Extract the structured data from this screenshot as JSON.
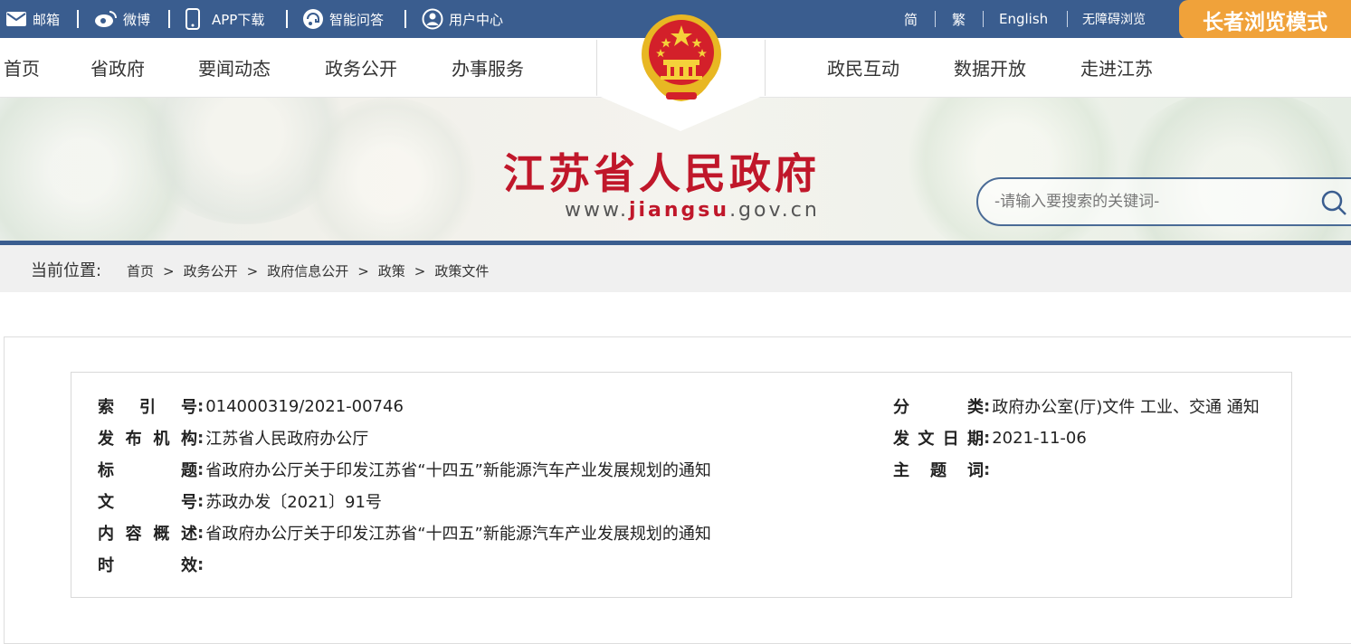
{
  "topbar": {
    "links": [
      "邮箱",
      "微博",
      "APP下载",
      "智能问答",
      "用户中心"
    ],
    "lang": [
      "简",
      "繁",
      "English",
      "无障碍浏览"
    ],
    "elder_mode": "长者浏览模式"
  },
  "nav": {
    "left": [
      "首页",
      "省政府",
      "要闻动态",
      "政务公开",
      "办事服务"
    ],
    "right": [
      "政民互动",
      "数据开放",
      "走进江苏"
    ]
  },
  "banner": {
    "title": "江苏省人民政府",
    "url_prefix": "www.",
    "url_highlight": "jiangsu",
    "url_suffix": ".gov.cn",
    "search_placeholder": "-请输入要搜索的关键词-"
  },
  "breadcrumb": {
    "label": "当前位置:",
    "items": [
      "首页",
      "政务公开",
      "政府信息公开",
      "政策",
      "政策文件"
    ],
    "separator": ">"
  },
  "info": {
    "index_no": {
      "label": "索引号",
      "value": "014000319/2021-00746"
    },
    "publisher": {
      "label": "发布机构",
      "value": "江苏省人民政府办公厅"
    },
    "title": {
      "label": "标题",
      "value": "省政府办公厅关于印发江苏省“十四五”新能源汽车产业发展规划的通知"
    },
    "doc_no": {
      "label": "文号",
      "value": "苏政办发〔2021〕91号"
    },
    "summary": {
      "label": "内容概述",
      "value": "省政府办公厅关于印发江苏省“十四五”新能源汽车产业发展规划的通知"
    },
    "validity": {
      "label": "时效",
      "value": ""
    },
    "category": {
      "label": "分类",
      "value": "政府办公室(厅)文件 工业、交通 通知"
    },
    "date": {
      "label": "发文日期",
      "value": "2021-11-06"
    },
    "keywords": {
      "label": "主题词",
      "value": ""
    }
  },
  "colors": {
    "topbar": "#3a5d8f",
    "elder": "#f0a23a",
    "title_red": "#c0172a"
  }
}
